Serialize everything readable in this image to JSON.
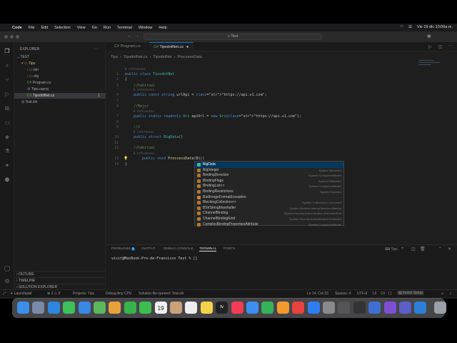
{
  "menubar": {
    "items": [
      "Code",
      "File",
      "Edit",
      "Selection",
      "View",
      "Go",
      "Run",
      "Terminal",
      "Window",
      "Help"
    ],
    "clock": "Vie 19 dic  10:00a.m."
  },
  "command_center": {
    "text": "Test"
  },
  "explorer": {
    "title": "EXPLORER",
    "root": "TEST",
    "items": [
      {
        "label": "Tips",
        "kind": "folder-open"
      },
      {
        "label": "bin",
        "kind": "folder"
      },
      {
        "label": "obj",
        "kind": "folder"
      },
      {
        "label": "Program.cs",
        "kind": "file-cs"
      },
      {
        "label": "Tips.csproj",
        "kind": "file-proj"
      },
      {
        "label": "TipsdotNet.cs",
        "kind": "file-cs",
        "badge": "1"
      },
      {
        "label": "Test.sln",
        "kind": "file-sln"
      }
    ],
    "sections": [
      "OUTLINE",
      "TIMELINE",
      "SOLUTION EXPLORER"
    ]
  },
  "tabs": [
    {
      "label": "Program.cs",
      "active": false
    },
    {
      "label": "TipsdotNet.cs",
      "active": true
    }
  ],
  "breadcrumb": [
    "Tips",
    "TipsdotNet.cs",
    "TipsdotNet",
    "ProccessData"
  ],
  "code": {
    "references_label": "0 references",
    "lines": [
      {
        "n": "1",
        "text": "public class TipsdotNet"
      },
      {
        "n": "2",
        "text": "{"
      },
      {
        "n": "3",
        "text": "    //habitual"
      },
      {
        "n": "4",
        "text": "    public const string urlApi = \"https://api.v1.com\";"
      },
      {
        "n": "5",
        "text": ""
      },
      {
        "n": "6",
        "text": "    //Mejor"
      },
      {
        "n": "7",
        "text": "    public static readonly Uri apiUrl = new Uri(\"https://api.v1.com\");"
      },
      {
        "n": "8",
        "text": ""
      },
      {
        "n": "9",
        "text": "    //2"
      },
      {
        "n": "10",
        "text": "    public struct BigData()"
      },
      {
        "n": "11",
        "text": ""
      },
      {
        "n": "12",
        "text": "    //habitual"
      },
      {
        "n": "13",
        "text": "    public void ProccessData(Bi|)"
      },
      {
        "n": "14",
        "text": "}"
      }
    ]
  },
  "suggestions": [
    {
      "name": "BigData",
      "ns": ""
    },
    {
      "name": "BigInteger",
      "ns": "System.Numerics"
    },
    {
      "name": "BindingDirection",
      "ns": "System.ComponentModel"
    },
    {
      "name": "BindingFlags",
      "ns": "System.Reflection"
    },
    {
      "name": "BindingList<>",
      "ns": "System.ComponentModel"
    },
    {
      "name": "BindingRestrictions",
      "ns": "System.Dynamic"
    },
    {
      "name": "BadImageFormatException",
      "ns": ""
    },
    {
      "name": "BlockingCollection<>",
      "ns": "System.Collections.Concurrent"
    },
    {
      "name": "BStrStringMarshaller",
      "ns": "System.Runtime.InteropServices.Marsha"
    },
    {
      "name": "ChannelBinding",
      "ns": "System.Security.Authentication.ExtendedProt"
    },
    {
      "name": "ChannelBindingKind",
      "ns": "System.Security.Authentication.Extended"
    },
    {
      "name": "ComplexBindingPropertiesAttribute",
      "ns": "System.ComponentModel"
    }
  ],
  "panel": {
    "tabs": [
      "PROBLEMS",
      "OUTPUT",
      "DEBUG CONSOLE",
      "TERMINAL",
      "PORTS"
    ],
    "problems_count": "1",
    "active_tab": "TERMINAL",
    "terminal_name": "Tips",
    "prompt": "visit@MacBook-Pro-de-Francisco Test % []"
  },
  "statusbar": {
    "launchpad": "Launchpad",
    "errors": "2",
    "warnings": "0",
    "projects": "Projects: Tips",
    "debug": "Debug Any CPU",
    "message": "Solution file opened: Test.sln",
    "position": "Ln 14, Col 33",
    "spaces": "Spaces: 4",
    "encoding": "UTF-8",
    "eol": "LF",
    "language": "C#",
    "finish_setup": "Finish Setup"
  },
  "dock": {
    "calendar_day": "19",
    "tv_label": "tv"
  },
  "colors": {
    "accent": "#0078d4",
    "selection": "#04395e"
  }
}
